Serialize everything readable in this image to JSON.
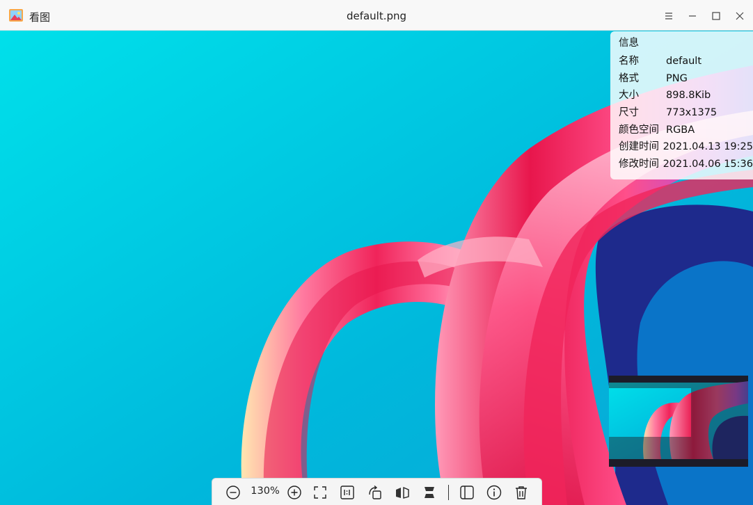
{
  "window": {
    "app_name": "看图",
    "title": "default.png",
    "menu_icon": "menu-icon",
    "minimize_icon": "minimize-icon",
    "maximize_icon": "maximize-icon",
    "close_icon": "close-icon"
  },
  "info": {
    "title": "信息",
    "rows": [
      {
        "key": "名称",
        "value": "default"
      },
      {
        "key": "格式",
        "value": "PNG"
      },
      {
        "key": "大小",
        "value": "898.8Kib"
      },
      {
        "key": "尺寸",
        "value": "773x1375"
      },
      {
        "key": "颜色空间",
        "value": "RGBA"
      },
      {
        "key": "创建时间",
        "value": "2021.04.13 19:25"
      },
      {
        "key": "修改时间",
        "value": "2021.04.06 15:36"
      }
    ]
  },
  "toolbar": {
    "zoom_level": "130%",
    "icons": [
      "zoom-out-icon",
      "zoom-in-icon",
      "fit-window-icon",
      "original-size-icon",
      "rotate-icon",
      "flip-horizontal-icon",
      "flip-vertical-icon",
      "sidebar-icon",
      "info-icon",
      "trash-icon"
    ]
  },
  "colors": {
    "background_cyan": "#00c2e0",
    "ribbon_pink": "#ff4f8a",
    "ribbon_red": "#e81e50",
    "ribbon_blue": "#1e2a8c"
  }
}
